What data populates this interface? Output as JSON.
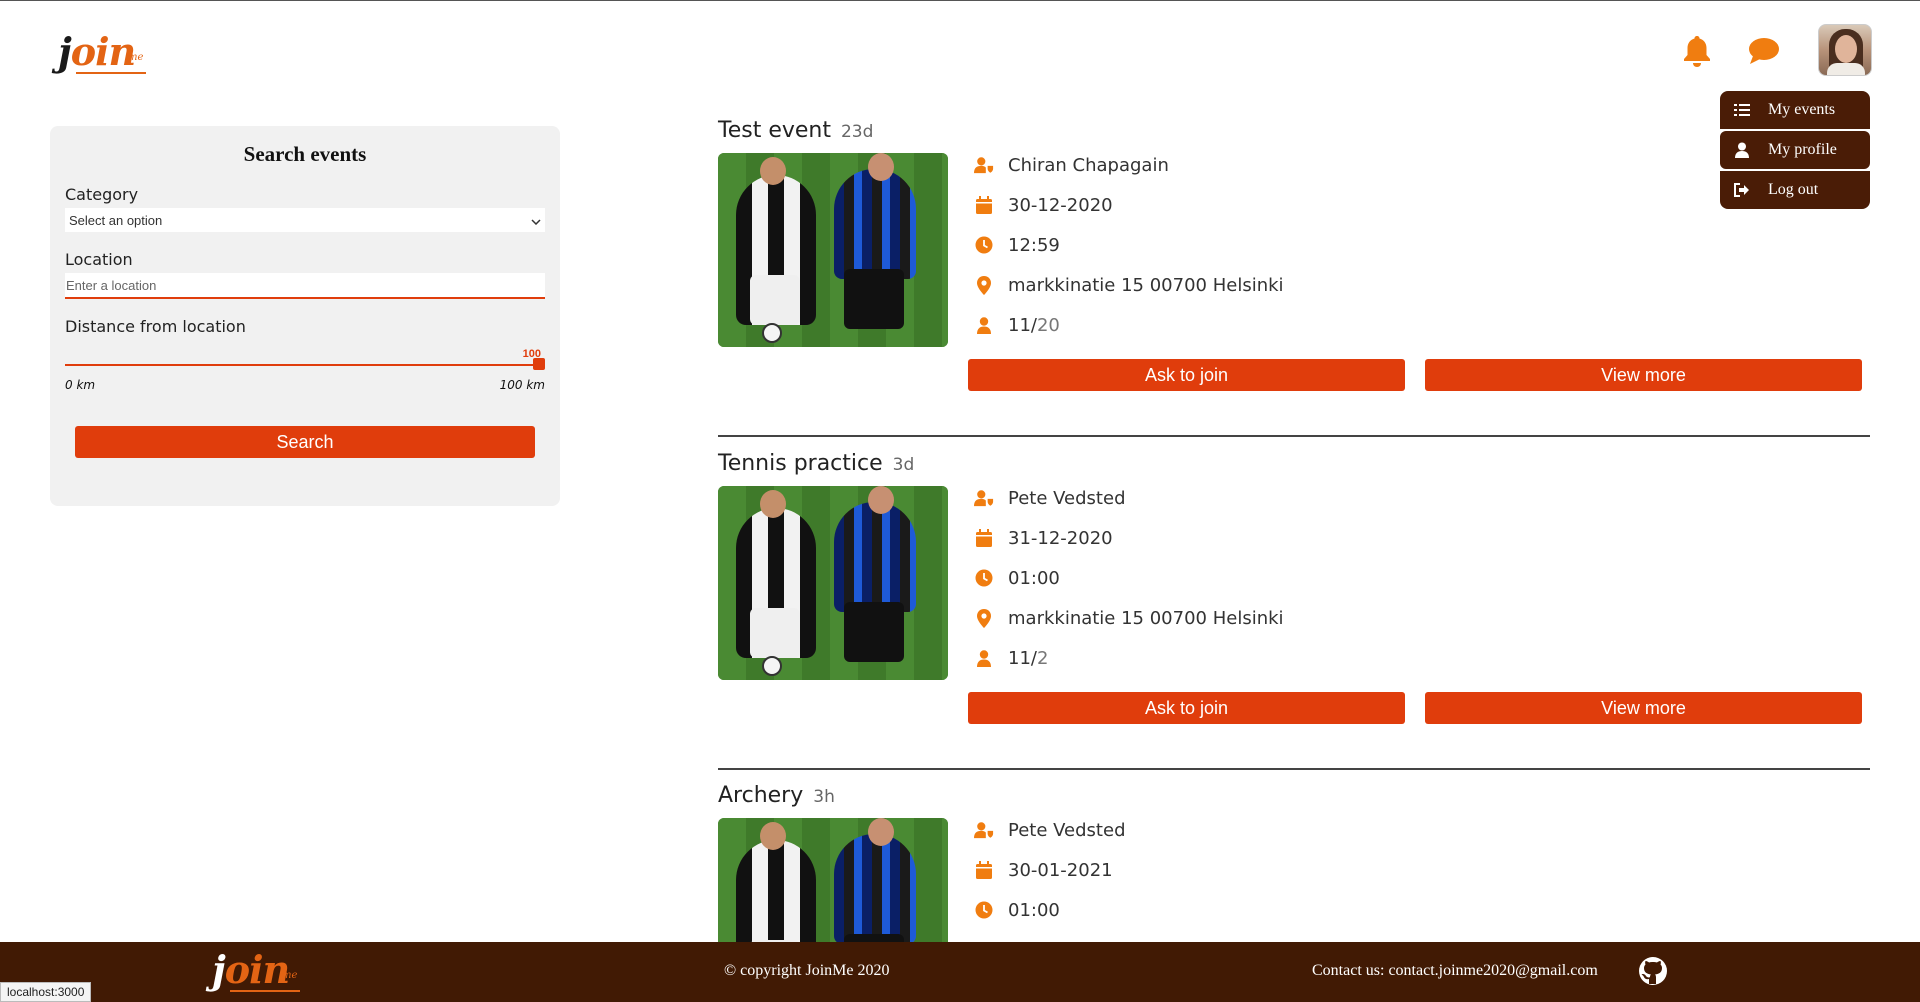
{
  "app": {
    "logo_text_j": "j",
    "logo_text_o": "o",
    "logo_text_in": "in",
    "logo_text_me": "me"
  },
  "header": {
    "notification_icon": "bell-icon",
    "messages_icon": "chat-bubble-icon",
    "avatar_icon": "user-avatar"
  },
  "user_menu": {
    "items": [
      {
        "label": "My events",
        "icon": "list-icon"
      },
      {
        "label": "My profile",
        "icon": "user-icon"
      },
      {
        "label": "Log out",
        "icon": "logout-icon"
      }
    ]
  },
  "search": {
    "title": "Search events",
    "category_label": "Category",
    "category_value": "Select an option",
    "location_label": "Location",
    "location_placeholder": "Enter a location",
    "distance_label": "Distance from location",
    "distance_value": "100",
    "distance_min": "0 km",
    "distance_max": "100 km",
    "distance_fraction": 1.0,
    "button_label": "Search"
  },
  "events": [
    {
      "name": "Test event",
      "age": "23d",
      "organizer": "Chiran Chapagain",
      "date": "30-12-2020",
      "time": "12:59",
      "address": "markkinatie 15 00700 Helsinki",
      "attendees": "11/",
      "capacity": "20",
      "join_label": "Ask to join",
      "more_label": "View more"
    },
    {
      "name": "Tennis practice",
      "age": "3d",
      "organizer": "Pete Vedsted",
      "date": "31-12-2020",
      "time": "01:00",
      "address": "markkinatie 15 00700 Helsinki",
      "attendees": "11/",
      "capacity": "2",
      "join_label": "Ask to join",
      "more_label": "View more"
    },
    {
      "name": "Archery",
      "age": "3h",
      "organizer": "Pete Vedsted",
      "date": "30-01-2021",
      "time": "01:00"
    }
  ],
  "footer": {
    "copyright": "© copyright JoinMe 2020",
    "contact": "Contact us: contact.joinme2020@gmail.com",
    "github_icon": "github-icon"
  },
  "statusbar": {
    "url": "localhost:3000"
  },
  "colors": {
    "accent": "#e03d0c",
    "icon_orange": "#f07d10",
    "menu_bg": "#4a1c06",
    "footer_bg": "#411a04",
    "panel_bg": "#f1f1f1"
  }
}
